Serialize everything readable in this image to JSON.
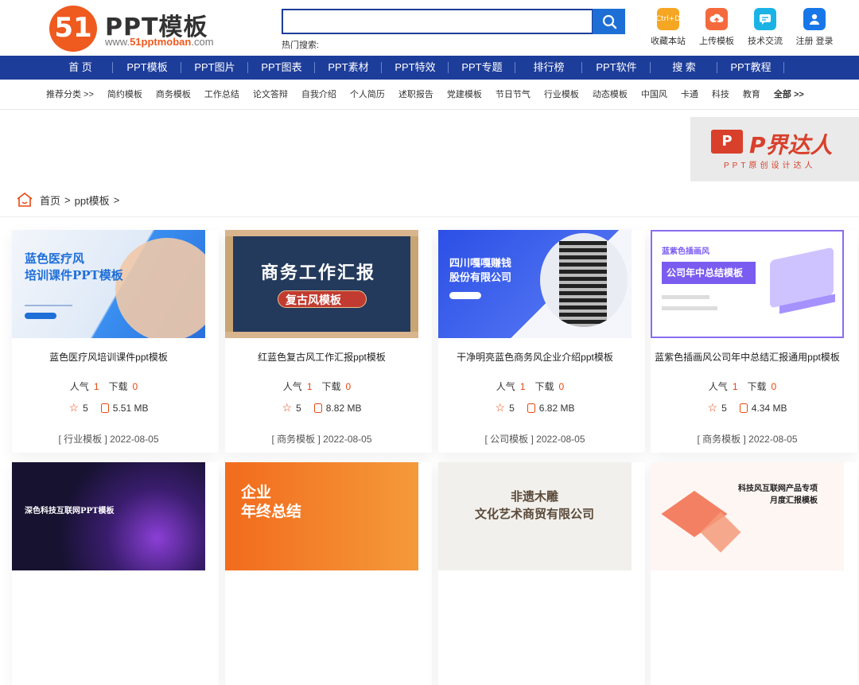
{
  "header": {
    "logo_mark": "51",
    "logo_title": "PPT模板",
    "logo_url_prefix": "www.",
    "logo_url_brand": "51pptmoban",
    "logo_url_suffix": ".com",
    "search_placeholder": "",
    "hot_label": "热门搜索:",
    "tools": [
      {
        "label": "收藏本站",
        "icon": "bookmark-icon",
        "icon_text": "Ctrl+D",
        "color": "#f5a623"
      },
      {
        "label": "上传模板",
        "icon": "upload-cloud-icon",
        "icon_text": "",
        "color": "#f56a3c"
      },
      {
        "label": "技术交流",
        "icon": "chat-icon",
        "icon_text": "",
        "color": "#1bb3e6"
      },
      {
        "label": "注册 登录",
        "icon": "user-icon",
        "icon_text": "",
        "color": "#1877e8"
      }
    ]
  },
  "nav": {
    "items": [
      "首 页",
      "PPT模板",
      "PPT图片",
      "PPT图表",
      "PPT素材",
      "PPT特效",
      "PPT专题",
      "排行榜",
      "PPT软件",
      "搜 索",
      "PPT教程"
    ]
  },
  "categories": {
    "items": [
      "推荐分类 >>",
      "简约模板",
      "商务模板",
      "工作总结",
      "论文答辩",
      "自我介绍",
      "个人简历",
      "述职报告",
      "党建模板",
      "节日节气",
      "行业模板",
      "动态模板",
      "中国风",
      "卡通",
      "科技",
      "教育"
    ],
    "all": "全部 >>"
  },
  "banner": {
    "icon_text": "P",
    "title": "P界达人",
    "subtitle": "PPT原创设计达人"
  },
  "breadcrumb": {
    "home": "首页",
    "sep": ">",
    "current": "ppt模板",
    "sep2": ">"
  },
  "cards": [
    {
      "title": "蓝色医疗风培训课件ppt模板",
      "popularity_label": "人气",
      "popularity": "1",
      "downloads_label": "下载",
      "downloads": "0",
      "rating": "5",
      "size": "5.51 MB",
      "category": "[ 行业模板 ]",
      "date": "2022-08-05",
      "thumb_text": "蓝色医疗风\n培训课件PPT模板",
      "thumb_bg": "#e7eef8"
    },
    {
      "title": "红蓝色复古风工作汇报ppt模板",
      "popularity_label": "人气",
      "popularity": "1",
      "downloads_label": "下载",
      "downloads": "0",
      "rating": "5",
      "size": "8.82 MB",
      "category": "[ 商务模板 ]",
      "date": "2022-08-05",
      "thumb_text": "商务工作汇报",
      "thumb_sub": "复古风模板",
      "thumb_bg": "#243a5c"
    },
    {
      "title": "干净明亮蓝色商务风企业介绍ppt模板",
      "popularity_label": "人气",
      "popularity": "1",
      "downloads_label": "下载",
      "downloads": "0",
      "rating": "5",
      "size": "6.82 MB",
      "category": "[ 公司模板 ]",
      "date": "2022-08-05",
      "thumb_text": "四川嘎嘎赚钱\n股份有限公司",
      "thumb_bg": "#3050e0"
    },
    {
      "title": "蓝紫色插画风公司年中总结汇报通用ppt模板",
      "popularity_label": "人气",
      "popularity": "1",
      "downloads_label": "下载",
      "downloads": "0",
      "rating": "5",
      "size": "4.34 MB",
      "category": "[ 商务模板 ]",
      "date": "2022-08-05",
      "thumb_text": "公司年中总结模板",
      "thumb_sub": "蓝紫色插画风",
      "thumb_bg": "#f3f2ff"
    }
  ],
  "cards_row2": [
    {
      "thumb_text": "深色科技互联网PPT模板",
      "thumb_bg": "#161230"
    },
    {
      "thumb_text": "企业\n年终总结",
      "thumb_bg": "#f07a22"
    },
    {
      "thumb_text": "非遗木雕\n文化艺术商贸有限公司",
      "thumb_bg": "#f2f0ec"
    },
    {
      "thumb_text": "科技风互联网产品专项\n月度汇报模板",
      "thumb_bg": "#fdf6f3"
    }
  ]
}
